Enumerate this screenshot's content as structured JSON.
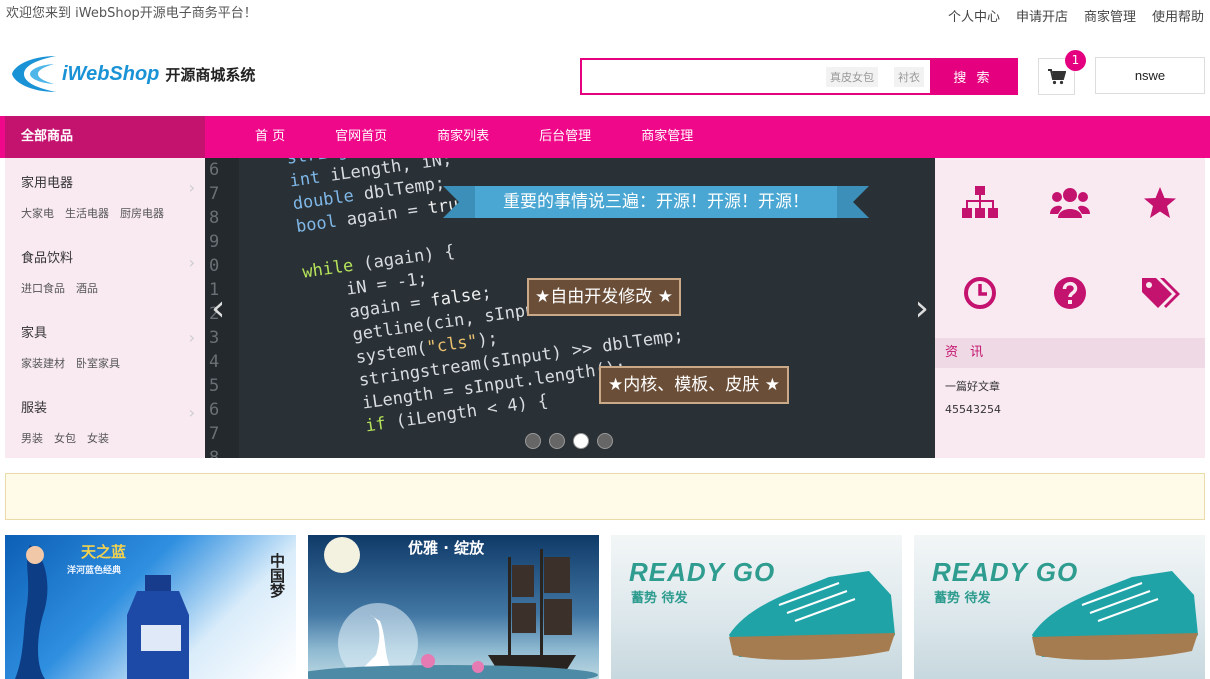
{
  "topbar": {
    "welcome": "欢迎您来到 iWebShop开源电子商务平台！",
    "links": [
      "个人中心",
      "申请开店",
      "商家管理",
      "使用帮助"
    ]
  },
  "logo": {
    "brand": "iWebShop",
    "subtitle": "开源商城系统"
  },
  "search": {
    "value": "",
    "hotwords": [
      "真皮女包",
      "衬衣"
    ],
    "button": "搜 索"
  },
  "cart": {
    "count": "1",
    "icon": "cart-icon"
  },
  "user": {
    "name": "nswe"
  },
  "nav": {
    "all_label": "全部商品",
    "items": [
      "首 页",
      "官网首页",
      "商家列表",
      "后台管理",
      "商家管理"
    ]
  },
  "categories": [
    {
      "title": "家用电器",
      "subs": [
        "大家电",
        "生活电器",
        "厨房电器"
      ]
    },
    {
      "title": "食品饮料",
      "subs": [
        "进口食品",
        "酒品"
      ]
    },
    {
      "title": "家具",
      "subs": [
        "家装建材",
        "卧室家具"
      ]
    },
    {
      "title": "服装",
      "subs": [
        "男装",
        "女包",
        "女装"
      ]
    }
  ],
  "banner": {
    "ribbon": "重要的事情说三遍：开源！开源！开源！",
    "plaque1": "★自由开发修改 ★",
    "plaque2": "★内核、模板、皮肤 ★",
    "slide_count": 4,
    "active_slide": 3
  },
  "shortcuts": [
    "sitemap-icon",
    "users-icon",
    "star-icon",
    "clock-icon",
    "question-icon",
    "tags-icon"
  ],
  "news": {
    "heading": "资 讯",
    "items": [
      "一篇好文章",
      "45543254"
    ]
  },
  "thumbs": [
    {
      "title": "天之蓝",
      "subtitle": "洋河蓝色经典",
      "side": "中国梦"
    },
    {
      "title": "优雅 · 绽放"
    },
    {
      "title": "READY GO",
      "subtitle": "蓄势 待发"
    },
    {
      "title": "READY GO",
      "subtitle": "蓄势 待发"
    }
  ],
  "colors": {
    "accent": "#f0088a",
    "accent_dark": "#c4126f",
    "panel_bg": "#f9eaf2",
    "logo_blue": "#1a93d6"
  }
}
